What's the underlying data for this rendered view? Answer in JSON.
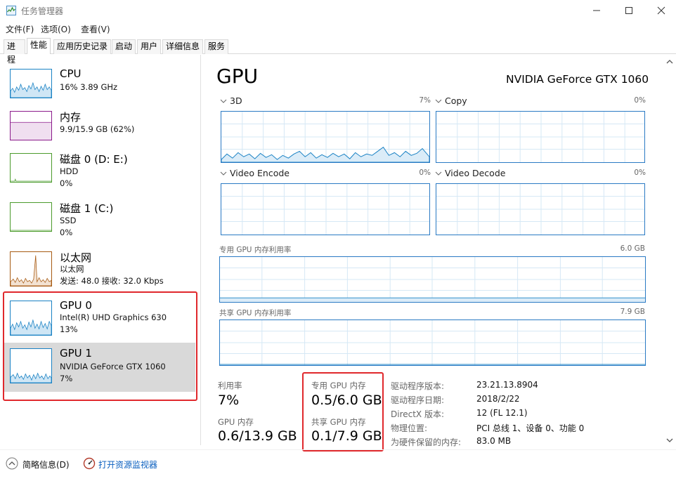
{
  "window": {
    "title": "任务管理器"
  },
  "menu": [
    "文件(F)",
    "选项(O)",
    "查看(V)"
  ],
  "tabs": [
    "进程",
    "性能",
    "应用历史记录",
    "启动",
    "用户",
    "详细信息",
    "服务"
  ],
  "resources": [
    {
      "title": "CPU",
      "lines": [
        "16% 3.89 GHz"
      ]
    },
    {
      "title": "内存",
      "lines": [
        "9.9/15.9 GB (62%)"
      ]
    },
    {
      "title": "磁盘 0 (D: E:)",
      "lines": [
        "HDD",
        "0%"
      ]
    },
    {
      "title": "磁盘 1 (C:)",
      "lines": [
        "SSD",
        "0%"
      ]
    },
    {
      "title": "以太网",
      "lines": [
        "以太网",
        "发送: 48.0  接收: 32.0 Kbps"
      ]
    },
    {
      "title": "GPU 0",
      "lines": [
        "Intel(R) UHD Graphics 630",
        "13%"
      ]
    },
    {
      "title": "GPU 1",
      "lines": [
        "NVIDIA GeForce GTX 1060",
        "7%"
      ]
    }
  ],
  "gpu": {
    "title": "GPU",
    "model": "NVIDIA GeForce GTX 1060",
    "engines": [
      {
        "name": "3D",
        "pct": "7%"
      },
      {
        "name": "Copy",
        "pct": "0%"
      },
      {
        "name": "Video Encode",
        "pct": "0%"
      },
      {
        "name": "Video Decode",
        "pct": "0%"
      }
    ],
    "dedicated_graph": {
      "label": "专用 GPU 内存利用率",
      "max": "6.0 GB"
    },
    "shared_graph": {
      "label": "共享 GPU 内存利用率",
      "max": "7.9 GB"
    },
    "stats": {
      "util_label": "利用率",
      "util_value": "7%",
      "gpu_mem_label": "GPU 内存",
      "gpu_mem_value": "0.6/13.9 GB",
      "dedicated_label": "专用 GPU 内存",
      "dedicated_value": "0.5/6.0 GB",
      "shared_label": "共享 GPU 内存",
      "shared_value": "0.1/7.9 GB"
    },
    "info": [
      {
        "label": "驱动程序版本:",
        "value": "23.21.13.8904"
      },
      {
        "label": "驱动程序日期:",
        "value": "2018/2/22"
      },
      {
        "label": "DirectX 版本:",
        "value": "12 (FL 12.1)"
      },
      {
        "label": "物理位置:",
        "value": "PCI 总线 1、设备 0、功能 0"
      },
      {
        "label": "为硬件保留的内存:",
        "value": "83.0 MB"
      }
    ]
  },
  "bottom": {
    "fewer_details": "简略信息(D)",
    "open_monitor": "打开资源监视器"
  },
  "colors": {
    "cpu": "#1a82c4",
    "memory": "#8b1a8b",
    "disk": "#4b9b2c",
    "ethernet": "#a75a12",
    "gpu": "#1a82c4",
    "highlight": "#e0282c"
  },
  "icons": {
    "app": "task-manager-icon",
    "collapse": "chevron-up-icon",
    "monitor": "resource-monitor-icon"
  }
}
